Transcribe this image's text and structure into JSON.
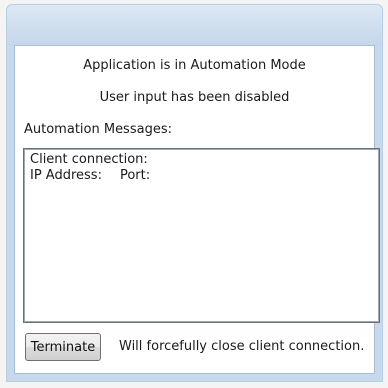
{
  "status": {
    "mode_text": "Application is in Automation Mode",
    "input_text": "User input has been disabled"
  },
  "messages": {
    "label": "Automation Messages:",
    "connection_text": "Client connection:",
    "ip_label": "IP Address:",
    "port_label": "Port:"
  },
  "footer": {
    "terminate_label": "Terminate",
    "note_text": "Will forcefully close client connection."
  }
}
